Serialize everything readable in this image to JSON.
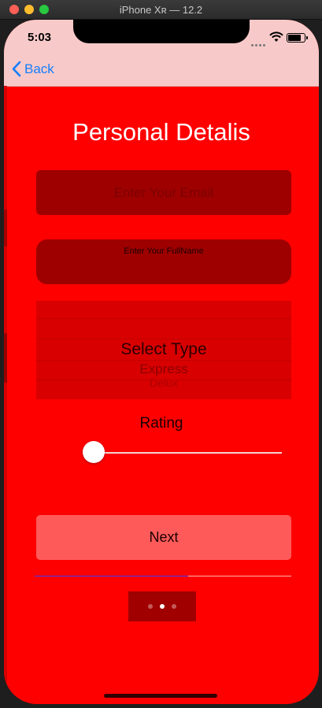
{
  "window": {
    "title": "iPhone Xʀ — 12.2"
  },
  "status_bar": {
    "time": "5:03"
  },
  "nav": {
    "back_label": "Back"
  },
  "form": {
    "title": "Personal Detalis",
    "email_placeholder": "Enter Your Email",
    "fullname_placeholder": "Enter Your FullName",
    "picker": {
      "selected": "Select Type",
      "options": [
        "Express",
        "Delux"
      ]
    },
    "rating_label": "Rating",
    "rating_value": 0,
    "next_label": "Next"
  },
  "page_control": {
    "count": 3,
    "current_index": 1
  },
  "colors": {
    "background": "#ff0000",
    "field": "#9e0000",
    "nav_bar": "#f8c9c9",
    "link": "#147efb",
    "next_button": "#ff5a5a"
  }
}
